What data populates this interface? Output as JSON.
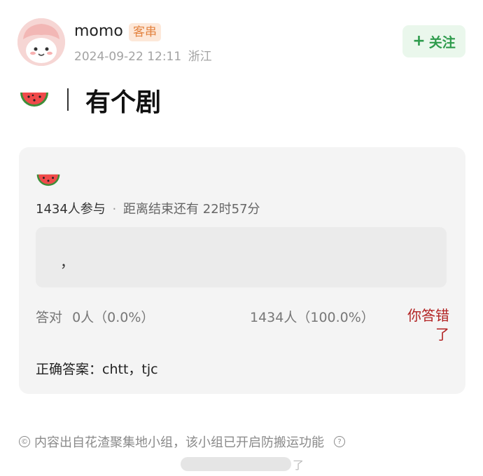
{
  "post": {
    "username": "momo",
    "tag": "客串",
    "timestamp": "2024-09-22 12:11",
    "location": "浙江",
    "follow_label": "关注",
    "follow_plus": "+",
    "title": "有个剧"
  },
  "quiz": {
    "participants": "1434人参与",
    "separator": "·",
    "remaining": "距离结束还有 22时57分",
    "answer_text": "，",
    "correct_stat_label": "答对",
    "correct_stat_value": "0人（0.0%）",
    "wrong_stat_value": "1434人（100.0%）",
    "result": "你答错了",
    "correct_answer": "正确答案：chtt，tjc"
  },
  "footer": {
    "notice": "内容出自花渣聚集地小组，该小组已开启防搬运功能",
    "copyright_symbol": "©",
    "help_symbol": "?",
    "watermark_tail": "了"
  }
}
